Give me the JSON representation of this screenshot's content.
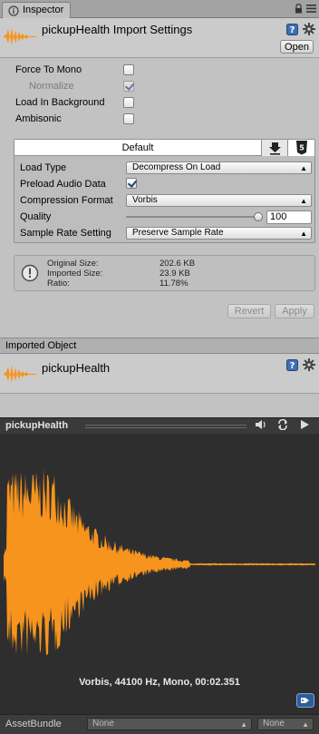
{
  "window": {
    "tab_title": "Inspector"
  },
  "header": {
    "title": "pickupHealth Import Settings",
    "open_button": "Open"
  },
  "import_settings": {
    "force_to_mono": {
      "label": "Force To Mono",
      "checked": false
    },
    "normalize": {
      "label": "Normalize",
      "checked": true,
      "disabled": true
    },
    "load_in_background": {
      "label": "Load In Background",
      "checked": false
    },
    "ambisonic": {
      "label": "Ambisonic",
      "checked": false
    }
  },
  "platform": {
    "default_tab": "Default",
    "load_type": {
      "label": "Load Type",
      "value": "Decompress On Load"
    },
    "preload_audio_data": {
      "label": "Preload Audio Data",
      "checked": true
    },
    "compression_format": {
      "label": "Compression Format",
      "value": "Vorbis"
    },
    "quality": {
      "label": "Quality",
      "value": "100",
      "level": 1.0
    },
    "sample_rate_setting": {
      "label": "Sample Rate Setting",
      "value": "Preserve Sample Rate"
    }
  },
  "info": {
    "original_size_label": "Original Size:",
    "original_size": "202.6 KB",
    "imported_size_label": "Imported Size:",
    "imported_size": "23.9 KB",
    "ratio_label": "Ratio:",
    "ratio": "11.78%"
  },
  "buttons": {
    "revert": "Revert",
    "apply": "Apply"
  },
  "imported_object": {
    "section_title": "Imported Object",
    "name": "pickupHealth"
  },
  "preview": {
    "title": "pickupHealth",
    "caption": "Vorbis, 44100 Hz, Mono, 00:02.351"
  },
  "asset_bundle": {
    "label": "AssetBundle",
    "name_value": "None",
    "variant_value": "None"
  },
  "colors": {
    "waveform": "#f7941d",
    "preview_bg": "#2e2e2e",
    "panel_bg": "#c2c2c2"
  }
}
